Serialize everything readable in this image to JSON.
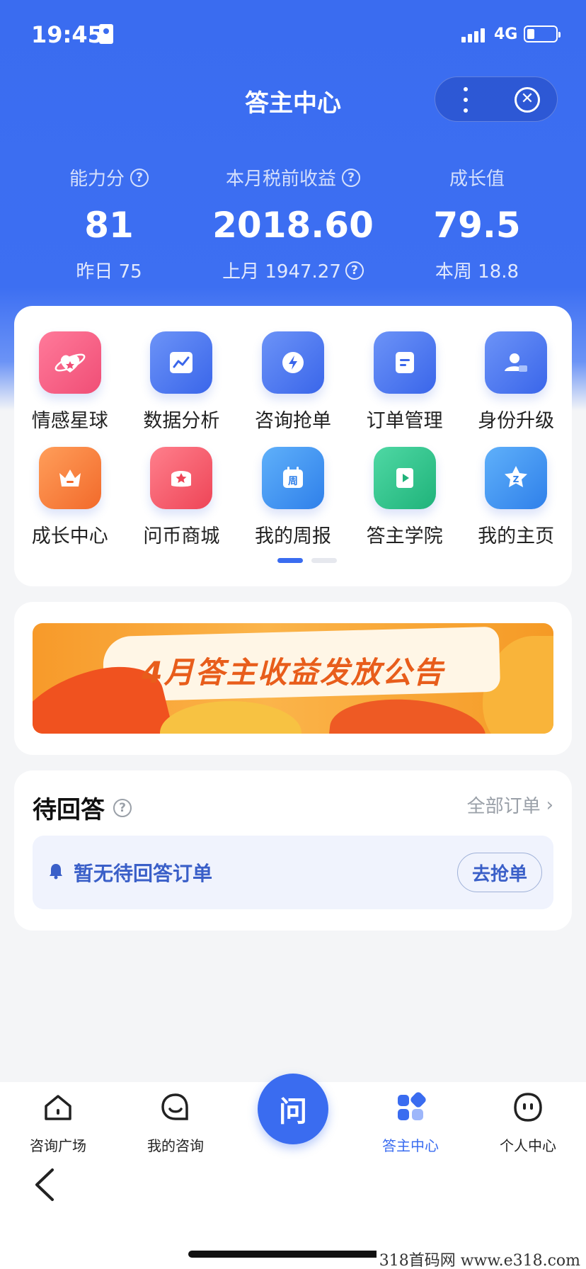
{
  "status": {
    "time": "19:45",
    "network": "4G"
  },
  "nav": {
    "title": "答主中心",
    "more_icon": "more-dots-icon",
    "close_icon": "close-circle-icon"
  },
  "stats": [
    {
      "label": "能力分",
      "value": "81",
      "sub": "昨日 75"
    },
    {
      "label": "本月税前收益",
      "value": "2018.60",
      "sub": "上月 1947.27"
    },
    {
      "label": "成长值",
      "value": "79.5",
      "sub": "本周 18.8"
    }
  ],
  "grid": [
    {
      "label": "情感星球",
      "icon": "planet-heart-icon",
      "color": "#f25d7f"
    },
    {
      "label": "数据分析",
      "icon": "chart-icon",
      "color": "#4a76ee"
    },
    {
      "label": "咨询抢单",
      "icon": "lightning-chat-icon",
      "color": "#4a76ee"
    },
    {
      "label": "订单管理",
      "icon": "document-icon",
      "color": "#4a76ee"
    },
    {
      "label": "身份升级",
      "icon": "user-chat-icon",
      "color": "#4a76ee"
    },
    {
      "label": "成长中心",
      "icon": "crown-icon",
      "color": "#f5813a"
    },
    {
      "label": "问币商城",
      "icon": "star-mall-icon",
      "color": "#f2566b"
    },
    {
      "label": "我的周报",
      "icon": "calendar-icon",
      "color": "#3e8ef2"
    },
    {
      "label": "答主学院",
      "icon": "play-book-icon",
      "color": "#2fc28a"
    },
    {
      "label": "我的主页",
      "icon": "star-z-icon",
      "color": "#3e8ef2"
    }
  ],
  "pager": {
    "current": 1,
    "total": 2
  },
  "banner": {
    "text": "4月答主收益发放公告"
  },
  "pending": {
    "title": "待回答",
    "all_orders": "全部订单",
    "empty_msg": "暂无待回答订单",
    "grab_button": "去抢单"
  },
  "tabbar": [
    {
      "label": "咨询广场",
      "icon": "home-icon"
    },
    {
      "label": "我的咨询",
      "icon": "chat-smile-icon"
    },
    {
      "label": "问",
      "icon": "center-ask-button"
    },
    {
      "label": "答主中心",
      "icon": "apps-icon",
      "active": true
    },
    {
      "label": "个人中心",
      "icon": "face-icon"
    }
  ],
  "watermark": "318首码网  www.e318.com"
}
